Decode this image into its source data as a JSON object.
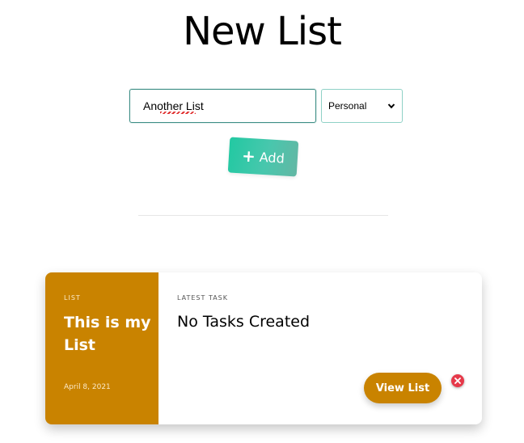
{
  "header": {
    "title": "New List"
  },
  "form": {
    "name_value": "Another List",
    "category_value": "Personal",
    "add_label": "Add"
  },
  "list_card": {
    "side_label": "LIST",
    "title": "This is my List",
    "date": "April 8, 2021",
    "task_label": "LATEST TASK",
    "task_text": "No Tasks Created",
    "view_label": "View List"
  },
  "icons": {
    "add": "plus-icon",
    "select": "chevron-down-icon",
    "delete": "close-circle-icon"
  },
  "colors": {
    "accent_teal": "#22c9a2",
    "card_gold": "#c98300",
    "delete_red": "#e6394a"
  }
}
